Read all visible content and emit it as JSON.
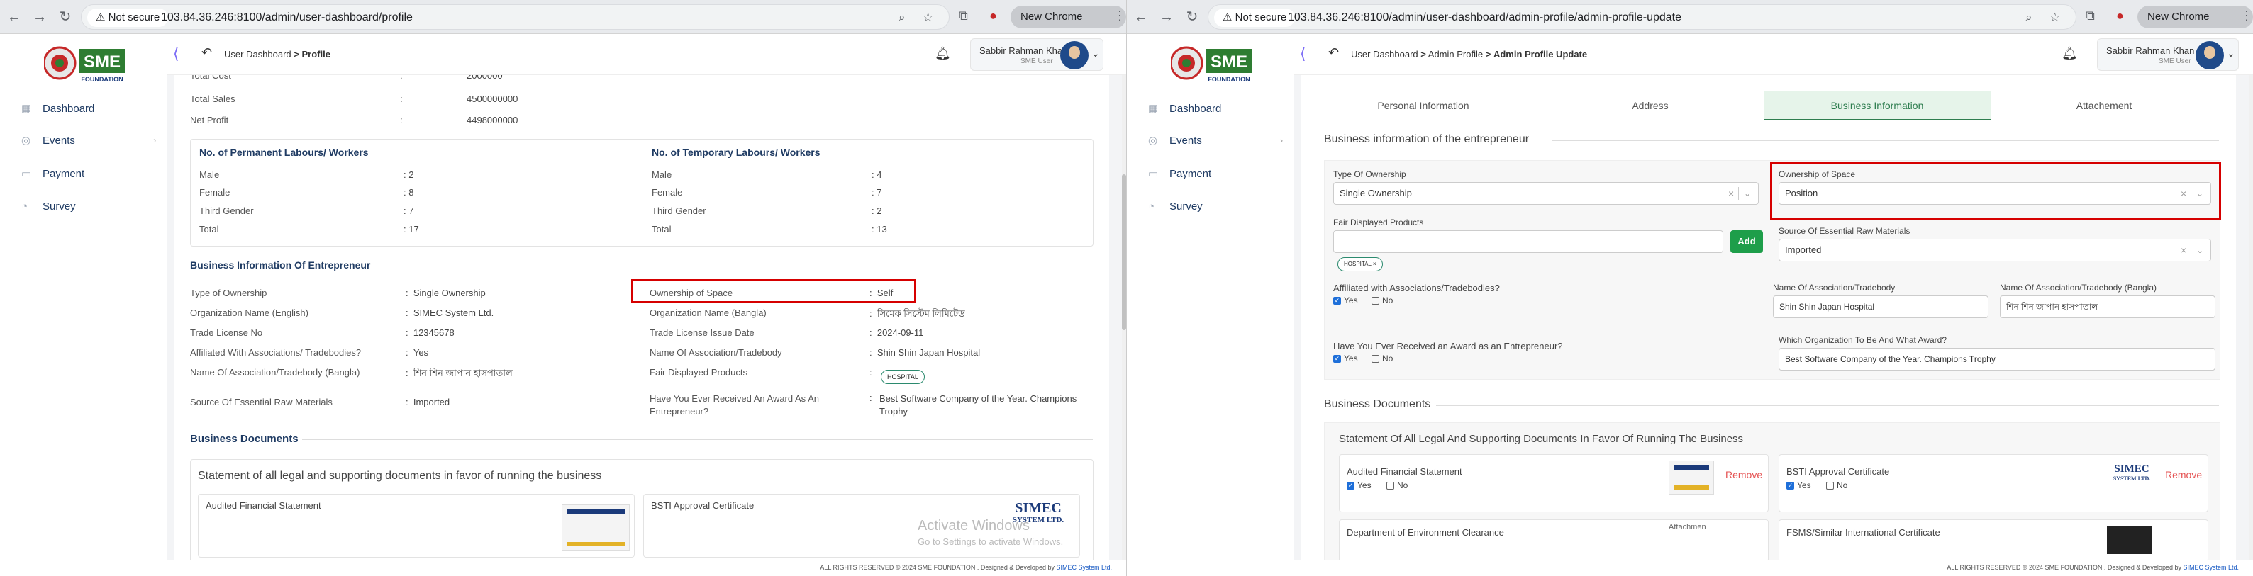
{
  "left": {
    "browser": {
      "not_secure": "Not secure",
      "url": "103.84.36.246:8100/admin/user-dashboard/profile",
      "new_chrome": "New Chrome available"
    },
    "sidebar": {
      "logo_text": "SME",
      "logo_sub": "FOUNDATION",
      "items": [
        {
          "label": "Dashboard",
          "icon": "grid-icon"
        },
        {
          "label": "Events",
          "icon": "event-icon"
        },
        {
          "label": "Payment",
          "icon": "payment-icon"
        },
        {
          "label": "Survey",
          "icon": "survey-icon"
        }
      ]
    },
    "topbar": {
      "breadcrumb_1": "User Dashboard",
      "breadcrumb_sep": ">",
      "breadcrumb_current": "Profile",
      "user_name": "Sabbir Rahman Khan",
      "user_role": "SME User"
    },
    "financials": [
      {
        "label": "Total Cost",
        "value": "2000000"
      },
      {
        "label": "Total Sales",
        "value": "4500000000"
      },
      {
        "label": "Net Profit",
        "value": "4498000000"
      }
    ],
    "permanent": {
      "title": "No. of Permanent Labours/ Workers",
      "rows": [
        {
          "label": "Male",
          "value": "2"
        },
        {
          "label": "Female",
          "value": "8"
        },
        {
          "label": "Third Gender",
          "value": "7"
        },
        {
          "label": "Total",
          "value": "17"
        }
      ]
    },
    "temporary": {
      "title": "No. of Temporary Labours/ Workers",
      "rows": [
        {
          "label": "Male",
          "value": "4"
        },
        {
          "label": "Female",
          "value": "7"
        },
        {
          "label": "Third Gender",
          "value": "2"
        },
        {
          "label": "Total",
          "value": "13"
        }
      ]
    },
    "business_info": {
      "title": "Business Information Of Entrepreneur",
      "left_rows": [
        {
          "label": "Type of Ownership",
          "value": "Single Ownership"
        },
        {
          "label": "Organization Name (English)",
          "value": "SIMEC System Ltd."
        },
        {
          "label": "Trade License No",
          "value": "12345678"
        },
        {
          "label": "Affiliated With Associations/ Tradebodies?",
          "value": "Yes"
        },
        {
          "label": "Name Of Association/Tradebody (Bangla)",
          "value": "শিন শিন জাপান হাসপাতাল"
        },
        {
          "label": "Source Of Essential Raw Materials",
          "value": "Imported"
        }
      ],
      "right_rows": [
        {
          "label": "Ownership of Space",
          "value": "Self"
        },
        {
          "label": "Organization Name (Bangla)",
          "value": "সিমেক সিস্টেম লিমিটেড"
        },
        {
          "label": "Trade License Issue Date",
          "value": "2024-09-11"
        },
        {
          "label": "Name Of Association/Tradebody",
          "value": "Shin Shin Japan Hospital"
        },
        {
          "label": "Fair Displayed Products",
          "value": "HOSPITAL"
        },
        {
          "label": "Have You Ever Received An Award As An Entrepreneur?",
          "value": "Best Software Company of the Year.  Champions Trophy"
        }
      ]
    },
    "documents": {
      "title": "Business Documents",
      "statement": "Statement of all legal and supporting documents in favor of running the business",
      "doc1": "Audited Financial Statement",
      "doc2": "BSTI Approval Certificate",
      "simec_logo": "SIMEC",
      "simec_sub": "SYSTEM LTD."
    },
    "watermark": {
      "line1": "Activate Windows",
      "line2": "Go to Settings to activate Windows."
    },
    "footer": {
      "text": "ALL RIGHTS RESERVED © 2024 SME FOUNDATION . Designed & Developed by ",
      "link": "SIMEC System Ltd."
    }
  },
  "right": {
    "browser": {
      "not_secure": "Not secure",
      "url": "103.84.36.246:8100/admin/user-dashboard/admin-profile/admin-profile-update",
      "new_chrome": "New Chrome available"
    },
    "topbar": {
      "breadcrumb_1": "User Dashboard",
      "breadcrumb_2": "Admin Profile",
      "breadcrumb_current": "Admin Profile Update",
      "user_name": "Sabbir Rahman Khan",
      "user_role": "SME User"
    },
    "tabs": [
      "Personal Information",
      "Address",
      "Business Information",
      "Attachement"
    ],
    "section_title": "Business information of the entrepreneur",
    "form": {
      "type_of_ownership_label": "Type Of Ownership",
      "type_of_ownership_value": "Single Ownership",
      "ownership_space_label": "Ownership of Space",
      "ownership_space_value": "Position",
      "fair_products_label": "Fair Displayed Products",
      "fair_products_tag": "HOSPITAL",
      "add_button": "Add",
      "raw_materials_label": "Source Of Essential Raw Materials",
      "raw_materials_value": "Imported",
      "affiliated_label": "Affiliated with Associations/Tradebodies?",
      "yes": "Yes",
      "no": "No",
      "assoc_name_label": "Name Of Association/Tradebody",
      "assoc_name_value": "Shin Shin Japan Hospital",
      "assoc_bangla_label": "Name Of Association/Tradebody (Bangla)",
      "assoc_bangla_value": "শিন শিন জাপান হাসপাতাল",
      "award_label": "Have You Ever Received an Award as an Entrepreneur?",
      "award_org_label": "Which Organization To Be And What Award?",
      "award_org_value": "Best Software Company of the Year.  Champions Trophy"
    },
    "documents": {
      "title": "Business Documents",
      "statement": "Statement Of All Legal And Supporting Documents In Favor Of Running The Business",
      "doc1": "Audited Financial Statement",
      "doc2": "BSTI Approval Certificate",
      "doc3": "Department of Environment Clearance",
      "doc4": "FSMS/Similar International Certificate",
      "remove": "Remove",
      "attachment_alt": "Attachmen"
    },
    "footer": {
      "text": "ALL RIGHTS RESERVED © 2024 SME FOUNDATION . Designed & Developed by ",
      "link": "SIMEC System Ltd."
    }
  }
}
